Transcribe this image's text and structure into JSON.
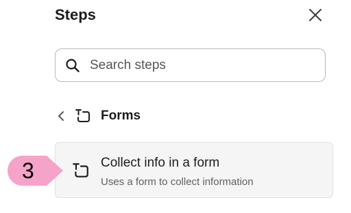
{
  "panel": {
    "title": "Steps",
    "close_icon": "close-icon"
  },
  "search": {
    "placeholder": "Search steps",
    "value": "",
    "icon": "search-icon"
  },
  "breadcrumb": {
    "back_icon": "chevron-left-icon",
    "category_icon": "form-icon",
    "label": "Forms"
  },
  "steps": [
    {
      "title": "Collect info in a form",
      "description": "Uses a form to collect information",
      "icon": "form-icon"
    }
  ],
  "annotation": {
    "number": "3",
    "color": "#f5a3c8"
  },
  "colors": {
    "text_primary": "#1d1c1d",
    "text_secondary": "#616061",
    "card_bg": "#f5f5f5",
    "search_border": "#b8b8b8"
  }
}
